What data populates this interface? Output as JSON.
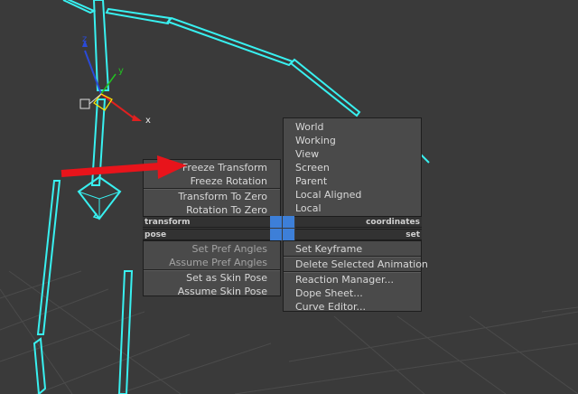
{
  "quad_menu": {
    "top_left": {
      "items": [
        {
          "label": "Freeze Transform",
          "enabled": true
        },
        {
          "label": "Freeze Rotation",
          "enabled": true
        },
        {
          "label": "Transform To Zero",
          "enabled": true
        },
        {
          "label": "Rotation To Zero",
          "enabled": true
        }
      ]
    },
    "top_right": {
      "items": [
        {
          "label": "World",
          "enabled": true
        },
        {
          "label": "Working",
          "enabled": true
        },
        {
          "label": "View",
          "enabled": true
        },
        {
          "label": "Screen",
          "enabled": true
        },
        {
          "label": "Parent",
          "enabled": true
        },
        {
          "label": "Local Aligned",
          "enabled": true
        },
        {
          "label": "Local",
          "enabled": true
        }
      ]
    },
    "headers": {
      "top_left": "transform",
      "top_right": "coordinates",
      "bottom_left": "pose",
      "bottom_right": "set"
    },
    "bottom_left": {
      "items": [
        {
          "label": "Set Pref Angles",
          "enabled": false
        },
        {
          "label": "Assume Pref Angles",
          "enabled": false
        },
        {
          "label": "Set as Skin Pose",
          "enabled": true
        },
        {
          "label": "Assume Skin Pose",
          "enabled": true
        }
      ]
    },
    "bottom_right": {
      "items": [
        {
          "label": "Set Keyframe",
          "enabled": true
        },
        {
          "label": "Delete Selected Animation",
          "enabled": true
        },
        {
          "label": "Reaction Manager...",
          "enabled": true
        },
        {
          "label": "Dope Sheet...",
          "enabled": true
        },
        {
          "label": "Curve Editor...",
          "enabled": true
        }
      ]
    },
    "quad_indicator_color": "#3d7fd8"
  },
  "gizmo": {
    "axes": {
      "x": "x",
      "y": "y",
      "z": "z"
    },
    "colors": {
      "x": "#e02020",
      "y": "#22c422",
      "z": "#2a4ad8",
      "plane": "#ffe600"
    }
  },
  "annotation": {
    "arrow_color": "#e8141b",
    "target": "Freeze Transform"
  },
  "viewport": {
    "background": "#3a3a3a",
    "selection_color": "#38f0f0"
  }
}
